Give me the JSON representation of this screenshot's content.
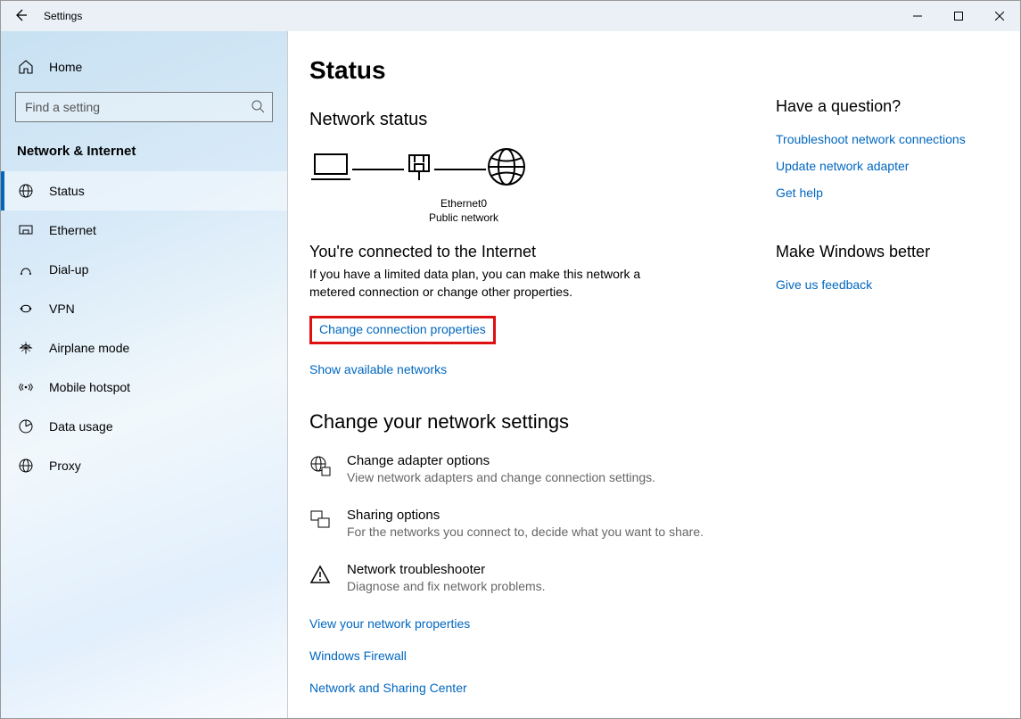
{
  "titlebar": {
    "title": "Settings"
  },
  "sidebar": {
    "home": "Home",
    "search_placeholder": "Find a setting",
    "section": "Network & Internet",
    "items": [
      {
        "label": "Status",
        "active": true
      },
      {
        "label": "Ethernet",
        "active": false
      },
      {
        "label": "Dial-up",
        "active": false
      },
      {
        "label": "VPN",
        "active": false
      },
      {
        "label": "Airplane mode",
        "active": false
      },
      {
        "label": "Mobile hotspot",
        "active": false
      },
      {
        "label": "Data usage",
        "active": false
      },
      {
        "label": "Proxy",
        "active": false
      }
    ]
  },
  "main": {
    "title": "Status",
    "network_status": "Network status",
    "diagram": {
      "adapter": "Ethernet0",
      "network_type": "Public network"
    },
    "connected_heading": "You're connected to the Internet",
    "connected_desc": "If you have a limited data plan, you can make this network a metered connection or change other properties.",
    "change_conn": "Change connection properties",
    "show_available": "Show available networks",
    "change_settings_heading": "Change your network settings",
    "options": [
      {
        "title": "Change adapter options",
        "desc": "View network adapters and change connection settings."
      },
      {
        "title": "Sharing options",
        "desc": "For the networks you connect to, decide what you want to share."
      },
      {
        "title": "Network troubleshooter",
        "desc": "Diagnose and fix network problems."
      }
    ],
    "bottom_links": [
      "View your network properties",
      "Windows Firewall",
      "Network and Sharing Center"
    ]
  },
  "rightcol": {
    "question": "Have a question?",
    "links": [
      "Troubleshoot network connections",
      "Update network adapter",
      "Get help"
    ],
    "improve_heading": "Make Windows better",
    "feedback": "Give us feedback"
  }
}
